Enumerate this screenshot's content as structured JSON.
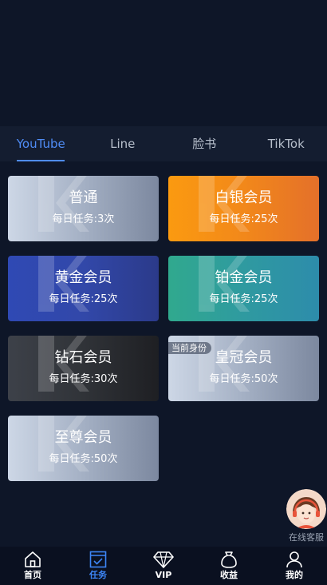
{
  "tabs": [
    {
      "label": "YouTube",
      "active": true
    },
    {
      "label": "Line"
    },
    {
      "label": "脸书"
    },
    {
      "label": "TikTok"
    }
  ],
  "levels": [
    {
      "name": "普通",
      "task": "每日任务:3次"
    },
    {
      "name": "白银会员",
      "task": "每日任务:25次"
    },
    {
      "name": "黄金会员",
      "task": "每日任务:25次"
    },
    {
      "name": "铂金会员",
      "task": "每日任务:25次"
    },
    {
      "name": "钻石会员",
      "task": "每日任务:30次"
    },
    {
      "name": "皇冠会员",
      "task": "每日任务:50次",
      "badge": "当前身份"
    },
    {
      "name": "至尊会员",
      "task": "每日任务:50次"
    }
  ],
  "support": {
    "label": "在线客服"
  },
  "nav": [
    {
      "label": "首页",
      "icon": "home-icon"
    },
    {
      "label": "任务",
      "icon": "task-icon",
      "active": true
    },
    {
      "label": "VIP",
      "icon": "diamond-icon"
    },
    {
      "label": "收益",
      "icon": "money-bag-icon"
    },
    {
      "label": "我的",
      "icon": "user-icon"
    }
  ],
  "colors": {
    "background": "#0e1628",
    "tab_active": "#4f8cf5",
    "nav_active": "#3d86f7"
  }
}
